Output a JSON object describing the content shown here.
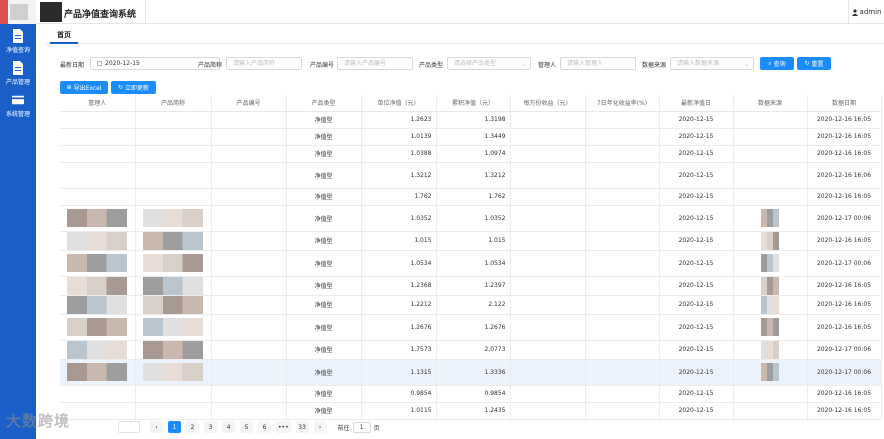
{
  "header": {
    "title": "产品净值查询系统",
    "user_name": "admin",
    "user_icon": "person-icon"
  },
  "sidebar": {
    "items": [
      {
        "label": "净值查询",
        "icon": "document-icon"
      },
      {
        "label": "产品管理",
        "icon": "document-icon"
      },
      {
        "label": "系统管理",
        "icon": "window-icon"
      }
    ]
  },
  "tabs": [
    {
      "label": "首页"
    }
  ],
  "filters": {
    "date_label": "最新日期",
    "date_value": "2020-12-15",
    "product_short_label": "产品简称",
    "product_short_placeholder": "请输入产品简称",
    "product_code_label": "产品编号",
    "product_code_placeholder": "请输入产品编号",
    "product_type_label": "产品类型",
    "product_type_placeholder": "请选择产品类型",
    "manager_label": "管理人",
    "manager_placeholder": "请输入管理人",
    "source_label": "数据来源",
    "source_placeholder": "请输入数据来源",
    "query_label": "查询",
    "reset_label": "重置",
    "export_label": "导出Excel",
    "update_label": "立即更新"
  },
  "table": {
    "columns": [
      "管理人",
      "产品简称",
      "产品编号",
      "产品类型",
      "单位净值（元）",
      "累积净值（元）",
      "每万份收益（元）",
      "7日年化收益率(%)",
      "最新净值日",
      "数据来源",
      "数据日期"
    ],
    "rows": [
      {
        "type": "净值型",
        "unit_nav": "1.2623",
        "acc_nav": "1.3198",
        "nav_date": "2020-12-15",
        "data_date": "2020-12-16 16:05"
      },
      {
        "type": "净值型",
        "unit_nav": "1.0139",
        "acc_nav": "1.3449",
        "nav_date": "2020-12-15",
        "data_date": "2020-12-16 16:05"
      },
      {
        "type": "净值型",
        "unit_nav": "1.0388",
        "acc_nav": "1.0974",
        "nav_date": "2020-12-15",
        "data_date": "2020-12-16 16:05"
      },
      {
        "type": "净值型",
        "unit_nav": "1.3212",
        "acc_nav": "1.3212",
        "nav_date": "2020-12-15",
        "data_date": "2020-12-16 16:06"
      },
      {
        "type": "净值型",
        "unit_nav": "1.762",
        "acc_nav": "1.762",
        "nav_date": "2020-12-15",
        "data_date": "2020-12-16 16:05"
      },
      {
        "type": "净值型",
        "unit_nav": "1.0352",
        "acc_nav": "1.0352",
        "nav_date": "2020-12-15",
        "data_date": "2020-12-17 00:06"
      },
      {
        "type": "净值型",
        "unit_nav": "1.015",
        "acc_nav": "1.015",
        "nav_date": "2020-12-15",
        "data_date": "2020-12-16 16:05"
      },
      {
        "type": "净值型",
        "unit_nav": "1.0534",
        "acc_nav": "1.0534",
        "nav_date": "2020-12-15",
        "data_date": "2020-12-17 00:06"
      },
      {
        "type": "净值型",
        "unit_nav": "1.2368",
        "acc_nav": "1.2397",
        "nav_date": "2020-12-15",
        "data_date": "2020-12-16 16:05"
      },
      {
        "type": "净值型",
        "unit_nav": "1.2212",
        "acc_nav": "2.122",
        "nav_date": "2020-12-15",
        "data_date": "2020-12-16 16:05"
      },
      {
        "type": "净值型",
        "unit_nav": "1.2676",
        "acc_nav": "1.2676",
        "nav_date": "2020-12-15",
        "data_date": "2020-12-16 16:05"
      },
      {
        "type": "净值型",
        "unit_nav": "1.7573",
        "acc_nav": "2.0773",
        "nav_date": "2020-12-15",
        "data_date": "2020-12-17 00:06"
      },
      {
        "type": "净值型",
        "unit_nav": "1.1315",
        "acc_nav": "1.3336",
        "nav_date": "2020-12-15",
        "data_date": "2020-12-17 00:06"
      },
      {
        "type": "净值型",
        "unit_nav": "0.9854",
        "acc_nav": "0.9854",
        "nav_date": "2020-12-15",
        "data_date": "2020-12-16 16:05"
      },
      {
        "type": "净值型",
        "unit_nav": "1.0115",
        "acc_nav": "1.2435",
        "nav_date": "2020-12-15",
        "data_date": "2020-12-16 16:05"
      }
    ],
    "highlighted_row": 12
  },
  "pagination": {
    "pages": [
      "1",
      "2",
      "3",
      "4",
      "5",
      "6",
      "•••",
      "33"
    ],
    "current": "1",
    "goto_prefix": "前往",
    "goto_value": "1",
    "goto_suffix": "页"
  },
  "watermark": "大数跨境",
  "colors": {
    "accent": "#1a8cff",
    "sidebar": "#1a5fc7",
    "highlight_row": "#edf3fd"
  }
}
